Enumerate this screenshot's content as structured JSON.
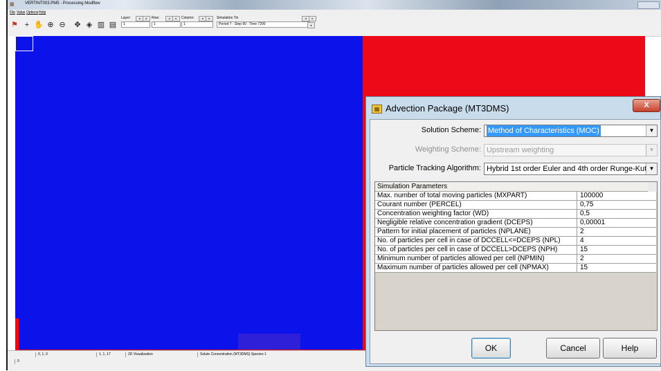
{
  "app": {
    "title": "VERTINT003.PM5 - Processing Modflow",
    "icon": "app-grid-icon"
  },
  "menu": {
    "items": [
      "File",
      "Value",
      "Options",
      "Help"
    ]
  },
  "toolbar": {
    "layer_label": "Layer:",
    "layer_value": "1",
    "row_label": "Row:",
    "row_value": "1",
    "column_label": "Column:",
    "column_value": "1",
    "simtime_label": "Simulation Tin",
    "simtime_value": "Period 7 : Step 60 : Time 7200"
  },
  "statusbar": {
    "coords": "0,     1,      0",
    "cell": "1, 1, 17",
    "mode": "2D Visualization",
    "layer_info": "Solute Concentration (MT3DMS) Species 1",
    "value": "0"
  },
  "dialog": {
    "title": "Advection Package (MT3DMS)",
    "close_glyph": "X",
    "solution_scheme_label": "Solution Scheme:",
    "solution_scheme_value": "Method of Characteristics (MOC)",
    "weighting_scheme_label": "Weighting Scheme:",
    "weighting_scheme_value": "Upstream weighting",
    "tracking_label": "Particle Tracking Algorithm:",
    "tracking_value": "Hybrid 1st order Euler and 4th order Runge-Kutta",
    "grid_header": "Simulation Parameters",
    "params": [
      {
        "name": "Max. number of total moving particles (MXPART)",
        "value": "100000"
      },
      {
        "name": "Courant number (PERCEL)",
        "value": "0,75"
      },
      {
        "name": "Concentration weighting factor (WD)",
        "value": "0,5"
      },
      {
        "name": "Negligible relative concentration gradient (DCEPS)",
        "value": "0,00001"
      },
      {
        "name": "Pattern for initial placement of particles (NPLANE)",
        "value": "2"
      },
      {
        "name": "No. of particles per cell in case of DCCELL<=DCEPS (NPL)",
        "value": "4"
      },
      {
        "name": "No. of particles per cell in case of DCCELL>DCEPS (NPH)",
        "value": "15"
      },
      {
        "name": "Minimum number of particles allowed per cell (NPMIN)",
        "value": "2"
      },
      {
        "name": "Maximum number of particles allowed per cell (NPMAX)",
        "value": "15"
      }
    ],
    "ok_label": "OK",
    "cancel_label": "Cancel",
    "help_label": "Help"
  },
  "colors": {
    "concentration_high": "#ec0a18",
    "concentration_low": "#0b12ea",
    "selection_highlight": "#3399ff"
  }
}
